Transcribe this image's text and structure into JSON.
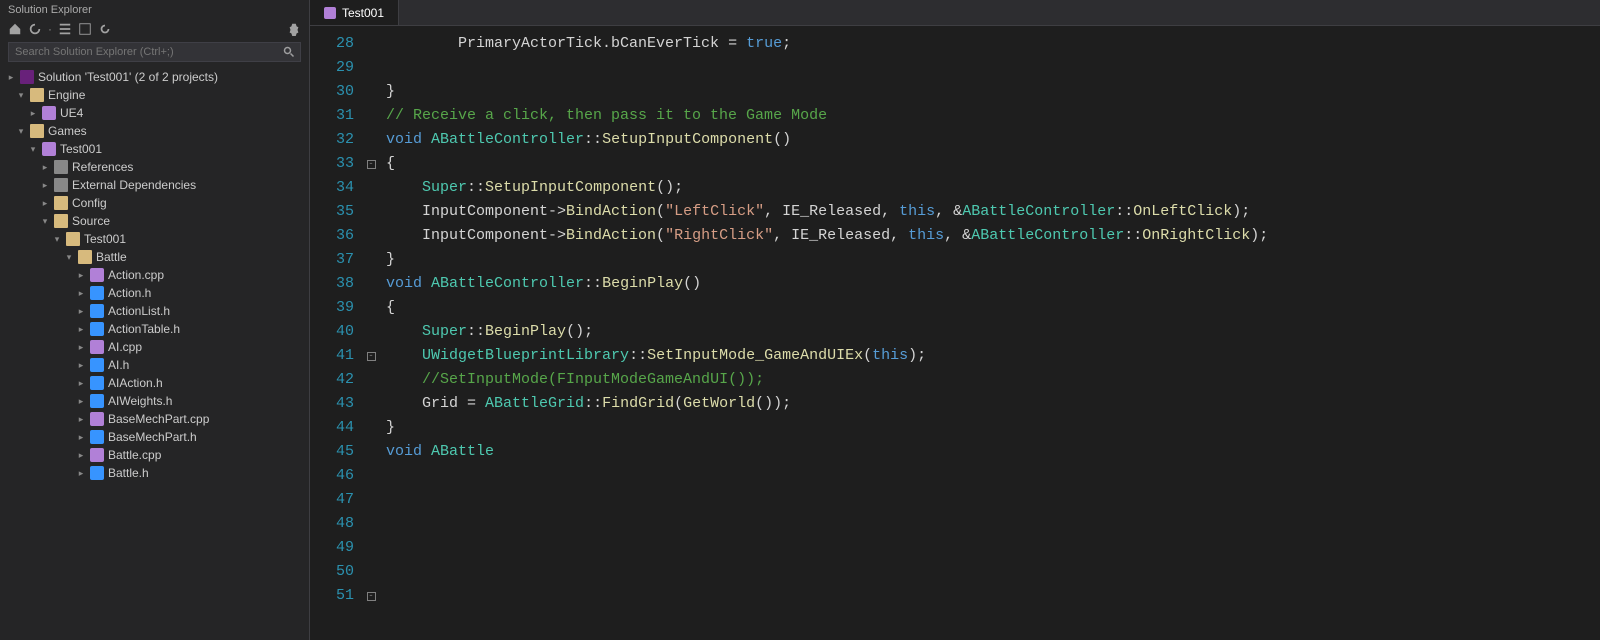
{
  "sidebar": {
    "title": "Solution Explorer",
    "search_placeholder": "Search Solution Explorer (Ctrl+;)",
    "solution_label": "Solution 'Test001' (2 of 2 projects)",
    "nodes": {
      "engine": "Engine",
      "ue4": "UE4",
      "games": "Games",
      "test001": "Test001",
      "references": "References",
      "external_deps": "External Dependencies",
      "config": "Config",
      "source": "Source",
      "test001_src": "Test001",
      "battle": "Battle",
      "files": [
        "Action.cpp",
        "Action.h",
        "ActionList.h",
        "ActionTable.h",
        "AI.cpp",
        "AI.h",
        "AIAction.h",
        "AIWeights.h",
        "BaseMechPart.cpp",
        "BaseMechPart.h",
        "Battle.cpp",
        "Battle.h"
      ]
    }
  },
  "editor": {
    "tab_label": "Test001",
    "first_line_no": 28,
    "lines": [
      {
        "fold": "",
        "tokens": [
          [
            "id",
            "        PrimaryActorTick.bCanEverTick "
          ],
          [
            "op",
            "= "
          ],
          [
            "const",
            "true"
          ],
          [
            "op",
            ";"
          ]
        ]
      },
      {
        "fold": "",
        "tokens": [
          [
            "id",
            "        "
          ]
        ]
      },
      {
        "fold": "",
        "tokens": [
          [
            "op",
            "}"
          ]
        ]
      },
      {
        "fold": "",
        "tokens": [
          [
            "id",
            ""
          ]
        ]
      },
      {
        "fold": "",
        "tokens": [
          [
            "cmt",
            "// Receive a click, then pass it to the Game Mode"
          ]
        ]
      },
      {
        "fold": "-",
        "tokens": [
          [
            "kw",
            "void "
          ],
          [
            "type",
            "ABattleController"
          ],
          [
            "op",
            "::"
          ],
          [
            "fn",
            "SetupInputComponent"
          ],
          [
            "op",
            "()"
          ]
        ]
      },
      {
        "fold": "",
        "tokens": [
          [
            "op",
            "{"
          ]
        ]
      },
      {
        "fold": "",
        "tokens": [
          [
            "id",
            "    "
          ],
          [
            "type",
            "Super"
          ],
          [
            "op",
            "::"
          ],
          [
            "fn",
            "SetupInputComponent"
          ],
          [
            "op",
            "();"
          ]
        ]
      },
      {
        "fold": "",
        "tokens": [
          [
            "id",
            ""
          ]
        ]
      },
      {
        "fold": "",
        "tokens": [
          [
            "id",
            "    InputComponent->"
          ],
          [
            "fn",
            "BindAction"
          ],
          [
            "op",
            "("
          ],
          [
            "str",
            "\"LeftClick\""
          ],
          [
            "op",
            ", "
          ],
          [
            "id",
            "IE_Released"
          ],
          [
            "op",
            ", "
          ],
          [
            "kw",
            "this"
          ],
          [
            "op",
            ", &"
          ],
          [
            "type",
            "ABattleController"
          ],
          [
            "op",
            "::"
          ],
          [
            "fn",
            "OnLeftClick"
          ],
          [
            "op",
            ");"
          ]
        ]
      },
      {
        "fold": "",
        "tokens": [
          [
            "id",
            "    InputComponent->"
          ],
          [
            "fn",
            "BindAction"
          ],
          [
            "op",
            "("
          ],
          [
            "str",
            "\"RightClick\""
          ],
          [
            "op",
            ", "
          ],
          [
            "id",
            "IE_Released"
          ],
          [
            "op",
            ", "
          ],
          [
            "kw",
            "this"
          ],
          [
            "op",
            ", &"
          ],
          [
            "type",
            "ABattleController"
          ],
          [
            "op",
            "::"
          ],
          [
            "fn",
            "OnRightClick"
          ],
          [
            "op",
            ");"
          ]
        ]
      },
      {
        "fold": "",
        "tokens": [
          [
            "op",
            "}"
          ]
        ]
      },
      {
        "fold": "",
        "tokens": [
          [
            "id",
            ""
          ]
        ]
      },
      {
        "fold": "-",
        "tokens": [
          [
            "kw",
            "void "
          ],
          [
            "type",
            "ABattleController"
          ],
          [
            "op",
            "::"
          ],
          [
            "fn",
            "BeginPlay"
          ],
          [
            "op",
            "()"
          ]
        ]
      },
      {
        "fold": "",
        "tokens": [
          [
            "op",
            "{"
          ]
        ]
      },
      {
        "fold": "",
        "tokens": [
          [
            "id",
            "    "
          ],
          [
            "type",
            "Super"
          ],
          [
            "op",
            "::"
          ],
          [
            "fn",
            "BeginPlay"
          ],
          [
            "op",
            "();"
          ]
        ]
      },
      {
        "fold": "",
        "tokens": [
          [
            "id",
            ""
          ]
        ]
      },
      {
        "fold": "",
        "tokens": [
          [
            "id",
            "    "
          ],
          [
            "type",
            "UWidgetBlueprintLibrary"
          ],
          [
            "op",
            "::"
          ],
          [
            "fn",
            "SetInputMode_GameAndUIEx"
          ],
          [
            "op",
            "("
          ],
          [
            "kw",
            "this"
          ],
          [
            "op",
            ");"
          ]
        ]
      },
      {
        "fold": "",
        "tokens": [
          [
            "id",
            "    "
          ],
          [
            "cmt",
            "//SetInputMode(FInputModeGameAndUI());"
          ]
        ]
      },
      {
        "fold": "",
        "tokens": [
          [
            "id",
            ""
          ]
        ]
      },
      {
        "fold": "",
        "tokens": [
          [
            "id",
            "    Grid "
          ],
          [
            "op",
            "= "
          ],
          [
            "type",
            "ABattleGrid"
          ],
          [
            "op",
            "::"
          ],
          [
            "fn",
            "FindGrid"
          ],
          [
            "op",
            "("
          ],
          [
            "fn",
            "GetWorld"
          ],
          [
            "op",
            "());"
          ]
        ]
      },
      {
        "fold": "",
        "tokens": [
          [
            "op",
            "}"
          ]
        ]
      },
      {
        "fold": "",
        "tokens": [
          [
            "id",
            ""
          ]
        ]
      },
      {
        "fold": "-",
        "tokens": [
          [
            "kw",
            "void "
          ],
          [
            "type",
            "ABattle"
          ]
        ]
      }
    ]
  }
}
